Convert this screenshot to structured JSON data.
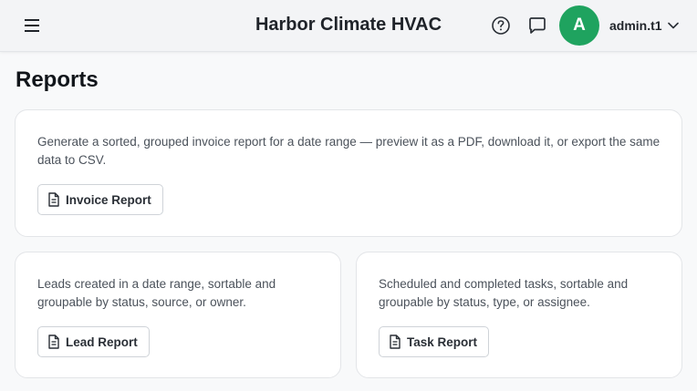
{
  "header": {
    "app_title": "Harbor Climate HVAC",
    "avatar_initial": "A",
    "username": "admin.t1",
    "icons": [
      "menu-icon",
      "help-icon",
      "chat-icon",
      "chevron-down-icon"
    ]
  },
  "page": {
    "title": "Reports"
  },
  "cards": {
    "invoice": {
      "description": "Generate a sorted, grouped invoice report for a date range — preview it as a PDF, download it, or export the same data to CSV.",
      "button_label": "Invoice Report",
      "button_icon": "document-icon"
    },
    "lead": {
      "description": "Leads created in a date range, sortable and groupable by status, source, or owner.",
      "button_label": "Lead Report",
      "button_icon": "document-icon"
    },
    "task": {
      "description": "Scheduled and completed tasks, sortable and groupable by status, type, or assignee.",
      "button_label": "Task Report",
      "button_icon": "document-icon"
    }
  },
  "colors": {
    "avatar_bg": "#1fa35f",
    "page_bg": "#f8f9fa",
    "card_border": "#e3e5e8"
  }
}
